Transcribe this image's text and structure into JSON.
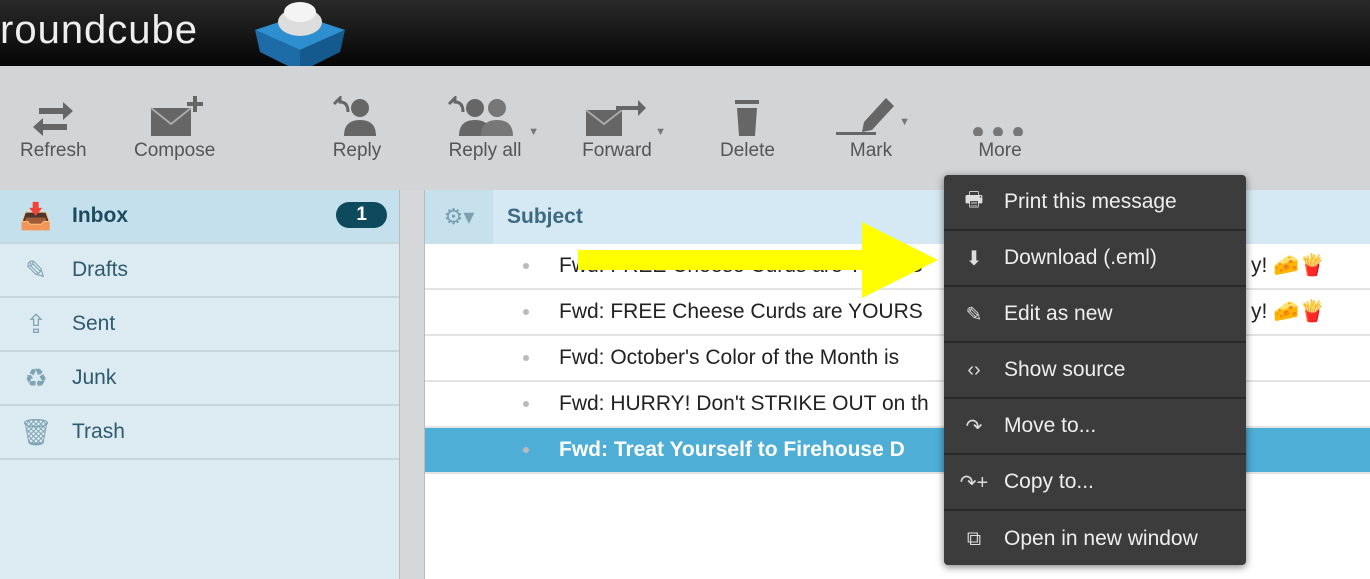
{
  "app": {
    "logo": "roundcube"
  },
  "toolbar": {
    "refresh": "Refresh",
    "compose": "Compose",
    "reply": "Reply",
    "reply_all": "Reply all",
    "forward": "Forward",
    "delete": "Delete",
    "mark": "Mark",
    "more": "More"
  },
  "folders": [
    {
      "label": "Inbox",
      "icon": "inbox-icon",
      "count": "1"
    },
    {
      "label": "Drafts",
      "icon": "pencil-icon"
    },
    {
      "label": "Sent",
      "icon": "sent-icon"
    },
    {
      "label": "Junk",
      "icon": "junk-icon"
    },
    {
      "label": "Trash",
      "icon": "trash-icon"
    }
  ],
  "list": {
    "subject_header": "Subject",
    "rows": [
      {
        "subject": "Fwd: FREE Cheese Curds are YOURS",
        "tail": "y! 🧀🍟"
      },
      {
        "subject": "Fwd: FREE Cheese Curds are YOURS",
        "tail": "y! 🧀🍟"
      },
      {
        "subject": "Fwd: October's Color of the Month is"
      },
      {
        "subject": "Fwd: HURRY! Don't STRIKE OUT on th"
      },
      {
        "subject": "Fwd: Treat Yourself to Firehouse D",
        "selected": true
      }
    ]
  },
  "menu": [
    {
      "label": "Print this message",
      "icon": "printer-icon"
    },
    {
      "label": "Download (.eml)",
      "icon": "download-icon"
    },
    {
      "label": "Edit as new",
      "icon": "pencil-icon"
    },
    {
      "label": "Show source",
      "icon": "code-icon"
    },
    {
      "label": "Move to...",
      "icon": "move-icon"
    },
    {
      "label": "Copy to...",
      "icon": "copy-icon"
    },
    {
      "label": "Open in new window",
      "icon": "new-window-icon"
    }
  ],
  "colors": {
    "selected_row": "#4eaed6",
    "annotation_arrow": "#ffff00",
    "menu_bg": "#3c3c3c"
  }
}
